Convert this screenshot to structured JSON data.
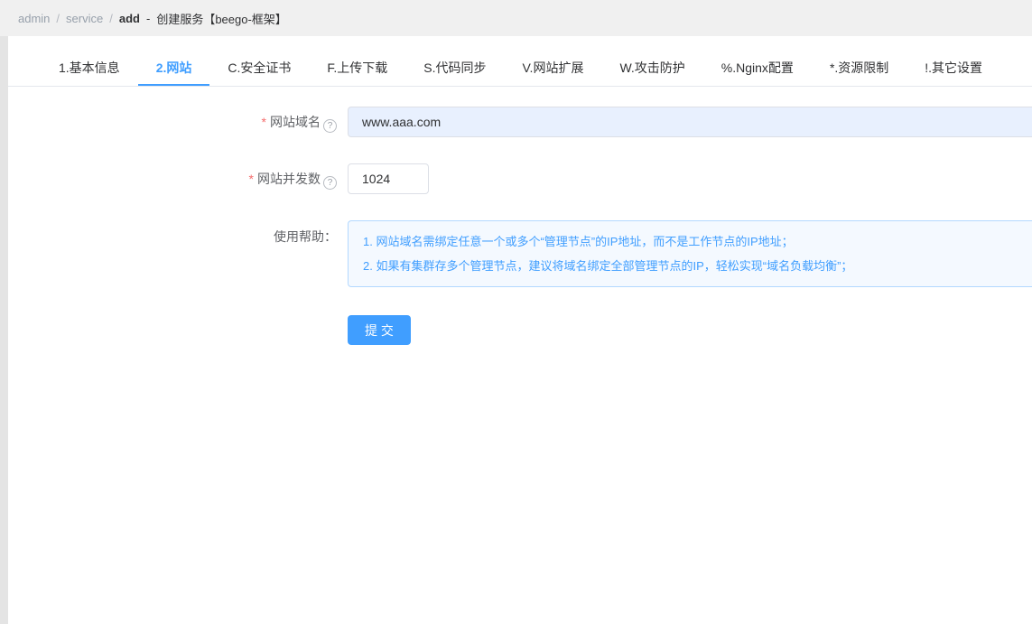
{
  "colors": {
    "accent": "#409eff",
    "required": "#f56c6c",
    "topbar_bg": "#f0f0f0",
    "help_box_bg": "#f4f9ff",
    "help_box_border": "#b3d8ff",
    "domain_input_bg": "#e8f0fe"
  },
  "breadcrumb": {
    "items": [
      "admin",
      "service",
      "add"
    ],
    "separator": "/",
    "dash": "-",
    "title": "创建服务【beego-框架】"
  },
  "tabs": [
    {
      "label": "1.基本信息"
    },
    {
      "label": "2.网站"
    },
    {
      "label": "C.安全证书"
    },
    {
      "label": "F.上传下载"
    },
    {
      "label": "S.代码同步"
    },
    {
      "label": "V.网站扩展"
    },
    {
      "label": "W.攻击防护"
    },
    {
      "label": "%.Nginx配置"
    },
    {
      "label": "*.资源限制"
    },
    {
      "label": "!.其它设置"
    }
  ],
  "form": {
    "required_mark": "*",
    "help_icon_char": "?",
    "domain": {
      "label": "网站域名",
      "value": "www.aaa.com"
    },
    "concurrency": {
      "label": "网站并发数",
      "value": "1024"
    },
    "help": {
      "label": "使用帮助：",
      "lines": [
        "1. 网站域名需绑定任意一个或多个“管理节点”的IP地址，而不是工作节点的IP地址；",
        "2. 如果有集群存多个管理节点，建议将域名绑定全部管理节点的IP，轻松实现“域名负载均衡”；"
      ]
    },
    "submit_label": "提 交"
  }
}
